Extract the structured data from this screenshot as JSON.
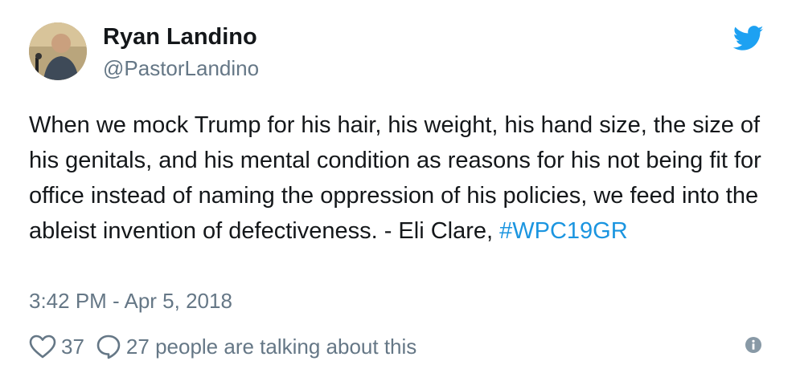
{
  "user": {
    "name": "Ryan Landino",
    "handle": "@PastorLandino",
    "avatar_icon": "profile-photo"
  },
  "brand": {
    "icon": "twitter-bird-icon",
    "color": "#1da1f2"
  },
  "tweet": {
    "text": "When we mock Trump for his hair, his weight, his hand size, the size of his genitals, and his mental condition as reasons for his not being fit for office instead of naming the oppression of his policies, we feed into the ableist invention of defectiveness. - Eli Clare, ",
    "hashtag": "#WPC19GR",
    "hashtag_color": "#1b95e0",
    "timestamp": "3:42 PM - Apr 5, 2018"
  },
  "actions": {
    "like_icon": "heart-icon",
    "like_count": "37",
    "reply_icon": "speech-bubble-icon",
    "talking_text": "27 people are talking about this",
    "info_icon": "info-icon"
  }
}
